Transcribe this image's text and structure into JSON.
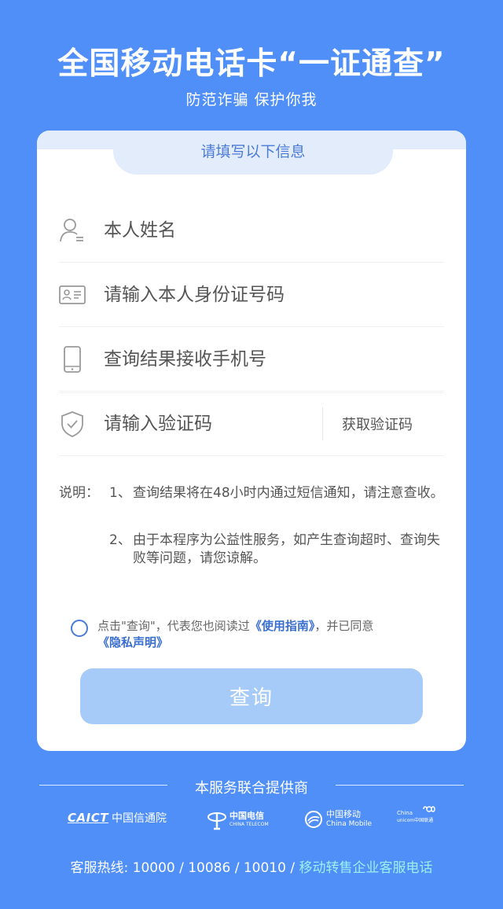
{
  "header": {
    "title": "全国移动电话卡“一证通查”",
    "subtitle": "防范诈骗 保护你我"
  },
  "form": {
    "heading": "请填写以下信息",
    "name_placeholder": "本人姓名",
    "id_placeholder": "请输入本人身份证号码",
    "phone_placeholder": "查询结果接收手机号",
    "code_placeholder": "请输入验证码",
    "get_code_label": "获取验证码"
  },
  "notes": {
    "label": "说明：",
    "items": [
      {
        "num": "1、",
        "text": "查询结果将在48小时内通过短信通知，请注意查收。"
      },
      {
        "num": "2、",
        "text": "由于本程序为公益性服务，如产生查询超时、查询失败等问题，请您谅解。"
      }
    ]
  },
  "agreement": {
    "prefix": "点击\"查询\"，代表您也阅读过",
    "guide_link": "《使用指南》",
    "middle": "，并已同意",
    "privacy_link": "《隐私声明》"
  },
  "query_button": "查询",
  "providers": {
    "title": "本服务联合提供商",
    "caict_mark": "CAICT",
    "caict_name": "中国信通院",
    "telecom_name": "中国电信",
    "telecom_en": "CHINA TELECOM",
    "mobile_name": "中国移动",
    "mobile_en": "China Mobile",
    "unicom_en1": "China",
    "unicom_en2": "unicom中国联通"
  },
  "hotline": {
    "label": "客服热线: 10000 / 10086 / 10010 / ",
    "link": "移动转售企业客服电话"
  },
  "colors": {
    "background": "#4f8ff7",
    "accent": "#4a7bd9",
    "button": "#a6cbf8",
    "link_cyan": "#9bf0f0"
  }
}
